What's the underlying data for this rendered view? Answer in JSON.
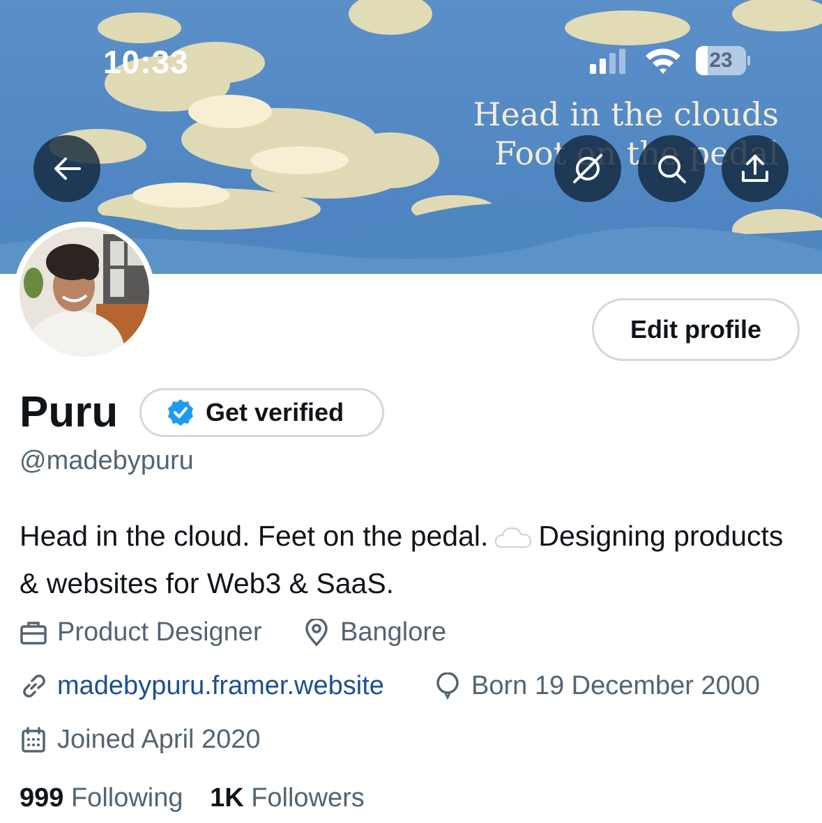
{
  "status_bar": {
    "time": "10:33",
    "battery": "23",
    "battery_level": 0.23
  },
  "banner": {
    "line1": "Head in the clouds",
    "line2": "Foot on the pedal"
  },
  "header_buttons": [
    "back-arrow-icon",
    "crypto-icon",
    "search-icon",
    "share-icon"
  ],
  "profile": {
    "edit_label": "Edit profile",
    "name": "Puru",
    "verify_label": "Get verified",
    "handle": "@madebypuru",
    "bio_part1": "Head in the cloud. Feet on the pedal.",
    "bio_part2": "Designing products & websites for Web3 & SaaS.",
    "profession": "Product Designer",
    "location": "Banglore",
    "website": "madebypuru.framer.website",
    "birthday": "Born 19 December 2000",
    "joined": "Joined April 2020"
  },
  "stats": {
    "following_count": "999",
    "following_label": "Following",
    "followers_count": "1K",
    "followers_label": "Followers"
  },
  "colors": {
    "verified_blue": "#1d9bf0",
    "link": "#1d4f91",
    "secondary_text": "#536471",
    "border": "#cfd9de"
  }
}
